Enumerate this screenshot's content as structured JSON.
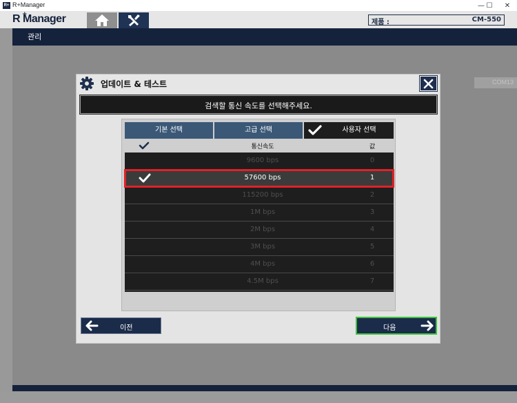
{
  "window": {
    "title": "R+Manager",
    "app_icon_text": "R+",
    "minimize": "—",
    "maximize": "☐",
    "close": "✕"
  },
  "header": {
    "logo": "R Manager",
    "logo_plus": "+",
    "product_label": "제품 :",
    "product_value": "CM-550"
  },
  "nav": {
    "label": "관리"
  },
  "background": {
    "partial_button": "COM13"
  },
  "dialog": {
    "title": "업데이트 & 테스트",
    "instruction": "검색할 통신 속도를 선택해주세요.",
    "tabs": [
      {
        "label": "기본 선택"
      },
      {
        "label": "고급 선택"
      },
      {
        "label": "사용자 선택"
      }
    ],
    "columns": {
      "speed": "통신속도",
      "value": "값"
    },
    "rows": [
      {
        "speed": "9600 bps",
        "value": "0"
      },
      {
        "speed": "57600 bps",
        "value": "1"
      },
      {
        "speed": "115200 bps",
        "value": "2"
      },
      {
        "speed": "1M bps",
        "value": "3"
      },
      {
        "speed": "2M bps",
        "value": "4"
      },
      {
        "speed": "3M bps",
        "value": "5"
      },
      {
        "speed": "4M bps",
        "value": "6"
      },
      {
        "speed": "4.5M bps",
        "value": "7"
      }
    ],
    "prev_label": "이전",
    "next_label": "다음"
  },
  "colors": {
    "navy": "#14223c",
    "tab_blue": "#3b5877",
    "selected_outline": "#e02128",
    "next_border": "#3cc23c"
  }
}
